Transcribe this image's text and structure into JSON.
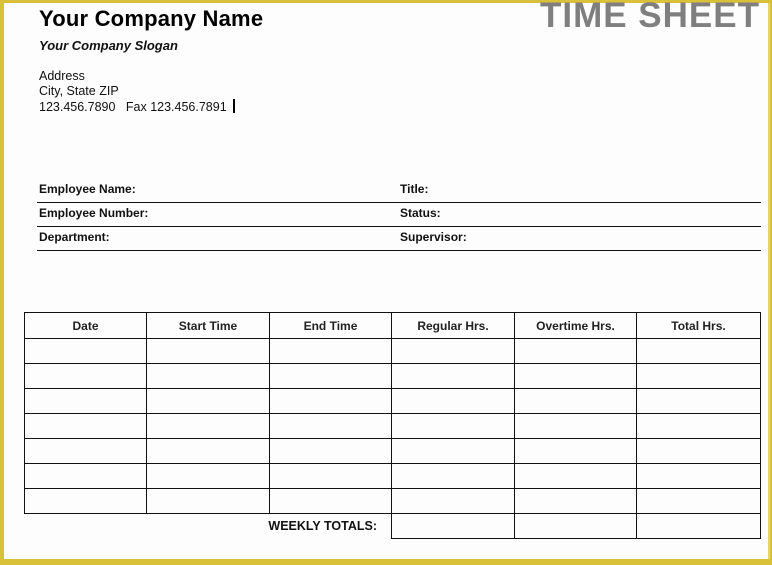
{
  "header": {
    "company_name": "Your Company Name",
    "slogan": "Your Company  Slogan",
    "address_lines": [
      "Address",
      "City, State ZIP",
      "123.456.7890   Fax 123.456.7891"
    ],
    "document_title": "TIME SHEET"
  },
  "employee_info": {
    "rows": [
      {
        "left_label": "Employee Name:",
        "right_label": "Title:"
      },
      {
        "left_label": "Employee Number:",
        "right_label": "Status:"
      },
      {
        "left_label": "Department:",
        "right_label": "Supervisor:"
      }
    ]
  },
  "timesheet": {
    "columns": [
      "Date",
      "Start Time",
      "End Time",
      "Regular Hrs.",
      "Overtime Hrs.",
      "Total Hrs."
    ],
    "rows": [
      [
        "",
        "",
        "",
        "",
        "",
        ""
      ],
      [
        "",
        "",
        "",
        "",
        "",
        ""
      ],
      [
        "",
        "",
        "",
        "",
        "",
        ""
      ],
      [
        "",
        "",
        "",
        "",
        "",
        ""
      ],
      [
        "",
        "",
        "",
        "",
        "",
        ""
      ],
      [
        "",
        "",
        "",
        "",
        "",
        ""
      ],
      [
        "",
        "",
        "",
        "",
        "",
        ""
      ]
    ],
    "totals_label": "WEEKLY TOTALS:",
    "totals": [
      "",
      "",
      ""
    ]
  },
  "colors": {
    "frame": "#d9c23a",
    "title_gray": "#7f7f7f"
  }
}
